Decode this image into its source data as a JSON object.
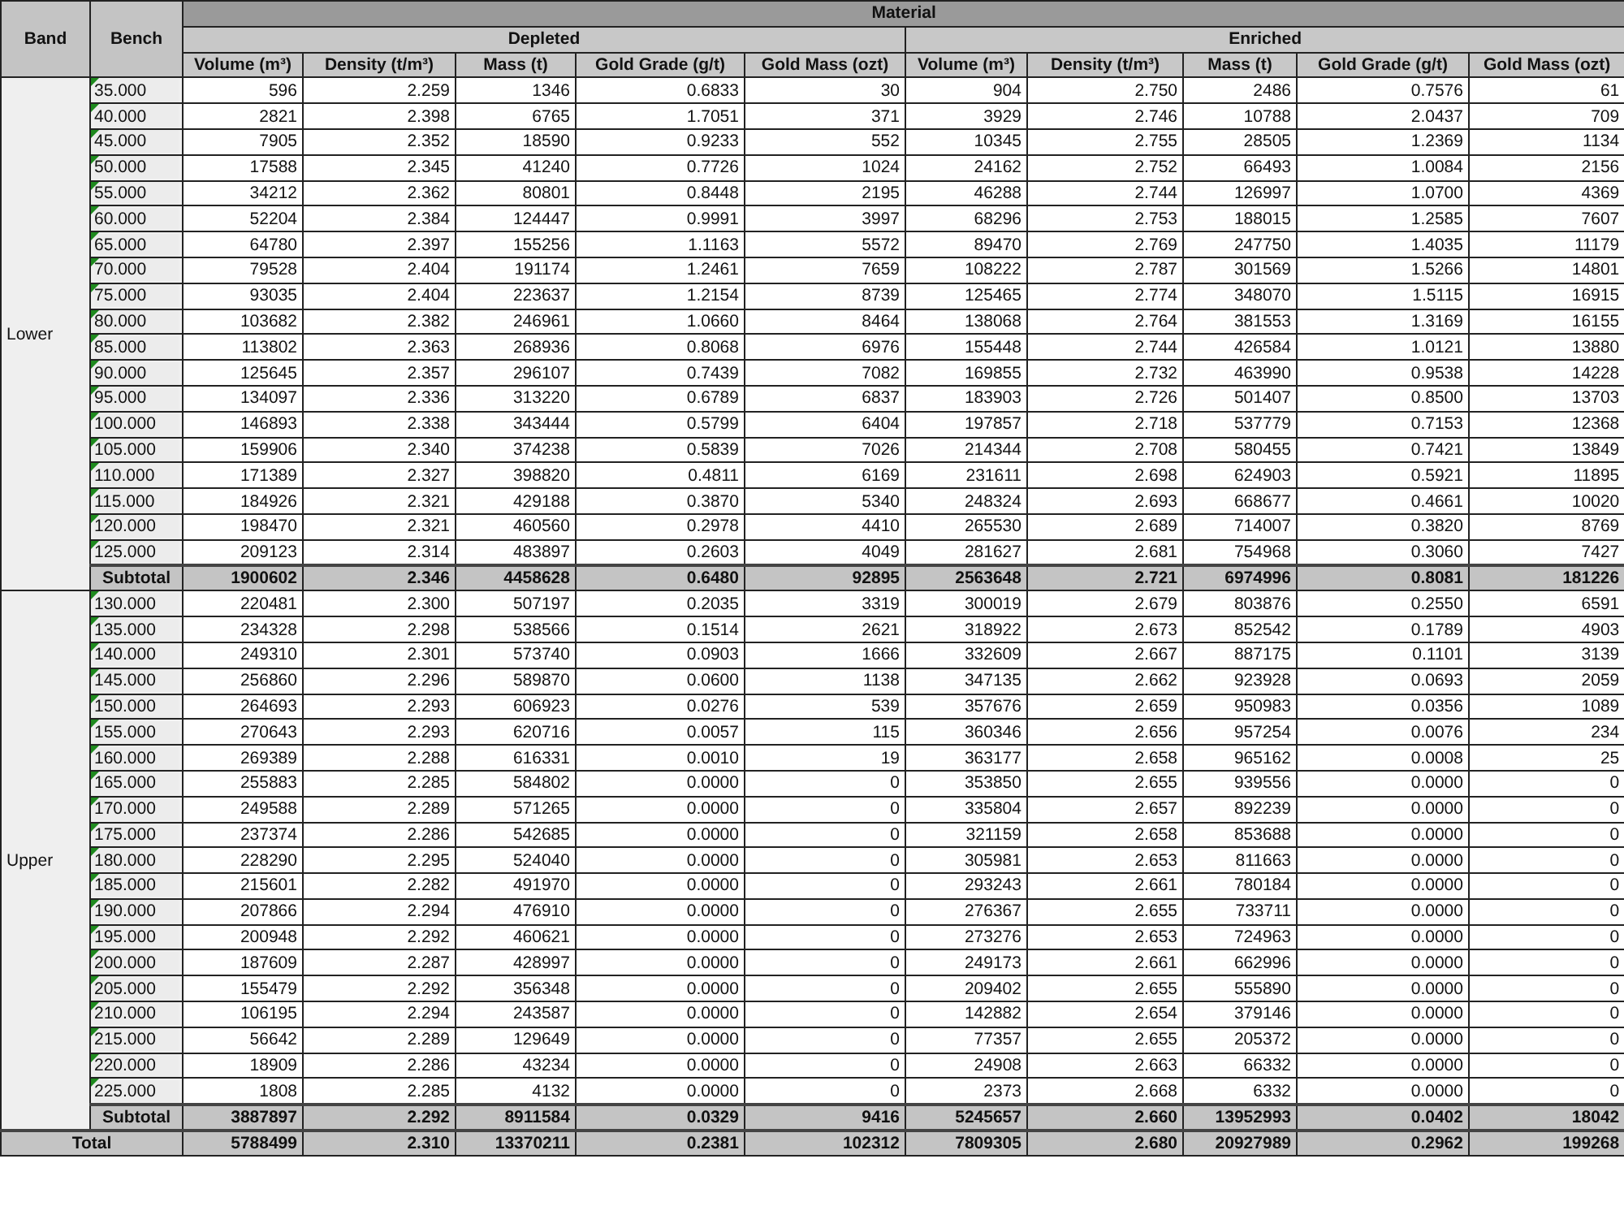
{
  "table": {
    "columns": [
      {
        "label": "Band"
      },
      {
        "label": "Bench"
      }
    ],
    "title": "Material",
    "groups": [
      {
        "name": "Depleted",
        "columns": [
          "Volume (m³)",
          "Density (t/m³)",
          "Mass (t)",
          "Gold Grade (g/t)",
          "Gold Mass (ozt)"
        ]
      },
      {
        "name": "Enriched",
        "columns": [
          "Volume (m³)",
          "Density (t/m³)",
          "Mass (t)",
          "Gold Grade (g/t)",
          "Gold Mass (ozt)"
        ]
      }
    ],
    "bands": [
      {
        "name": "Lower",
        "rows": [
          {
            "bench": "35.000",
            "flagged": true,
            "values": [
              "596",
              "2.259",
              "1346",
              "0.6833",
              "30",
              "904",
              "2.750",
              "2486",
              "0.7576",
              "61"
            ]
          },
          {
            "bench": "40.000",
            "flagged": true,
            "values": [
              "2821",
              "2.398",
              "6765",
              "1.7051",
              "371",
              "3929",
              "2.746",
              "10788",
              "2.0437",
              "709"
            ]
          },
          {
            "bench": "45.000",
            "flagged": true,
            "values": [
              "7905",
              "2.352",
              "18590",
              "0.9233",
              "552",
              "10345",
              "2.755",
              "28505",
              "1.2369",
              "1134"
            ]
          },
          {
            "bench": "50.000",
            "flagged": true,
            "values": [
              "17588",
              "2.345",
              "41240",
              "0.7726",
              "1024",
              "24162",
              "2.752",
              "66493",
              "1.0084",
              "2156"
            ]
          },
          {
            "bench": "55.000",
            "flagged": true,
            "values": [
              "34212",
              "2.362",
              "80801",
              "0.8448",
              "2195",
              "46288",
              "2.744",
              "126997",
              "1.0700",
              "4369"
            ]
          },
          {
            "bench": "60.000",
            "flagged": true,
            "values": [
              "52204",
              "2.384",
              "124447",
              "0.9991",
              "3997",
              "68296",
              "2.753",
              "188015",
              "1.2585",
              "7607"
            ]
          },
          {
            "bench": "65.000",
            "flagged": true,
            "values": [
              "64780",
              "2.397",
              "155256",
              "1.1163",
              "5572",
              "89470",
              "2.769",
              "247750",
              "1.4035",
              "11179"
            ]
          },
          {
            "bench": "70.000",
            "flagged": true,
            "values": [
              "79528",
              "2.404",
              "191174",
              "1.2461",
              "7659",
              "108222",
              "2.787",
              "301569",
              "1.5266",
              "14801"
            ]
          },
          {
            "bench": "75.000",
            "flagged": true,
            "values": [
              "93035",
              "2.404",
              "223637",
              "1.2154",
              "8739",
              "125465",
              "2.774",
              "348070",
              "1.5115",
              "16915"
            ]
          },
          {
            "bench": "80.000",
            "flagged": true,
            "values": [
              "103682",
              "2.382",
              "246961",
              "1.0660",
              "8464",
              "138068",
              "2.764",
              "381553",
              "1.3169",
              "16155"
            ]
          },
          {
            "bench": "85.000",
            "flagged": true,
            "values": [
              "113802",
              "2.363",
              "268936",
              "0.8068",
              "6976",
              "155448",
              "2.744",
              "426584",
              "1.0121",
              "13880"
            ]
          },
          {
            "bench": "90.000",
            "flagged": true,
            "values": [
              "125645",
              "2.357",
              "296107",
              "0.7439",
              "7082",
              "169855",
              "2.732",
              "463990",
              "0.9538",
              "14228"
            ]
          },
          {
            "bench": "95.000",
            "flagged": true,
            "values": [
              "134097",
              "2.336",
              "313220",
              "0.6789",
              "6837",
              "183903",
              "2.726",
              "501407",
              "0.8500",
              "13703"
            ]
          },
          {
            "bench": "100.000",
            "flagged": true,
            "values": [
              "146893",
              "2.338",
              "343444",
              "0.5799",
              "6404",
              "197857",
              "2.718",
              "537779",
              "0.7153",
              "12368"
            ]
          },
          {
            "bench": "105.000",
            "flagged": true,
            "values": [
              "159906",
              "2.340",
              "374238",
              "0.5839",
              "7026",
              "214344",
              "2.708",
              "580455",
              "0.7421",
              "13849"
            ]
          },
          {
            "bench": "110.000",
            "flagged": true,
            "values": [
              "171389",
              "2.327",
              "398820",
              "0.4811",
              "6169",
              "231611",
              "2.698",
              "624903",
              "0.5921",
              "11895"
            ]
          },
          {
            "bench": "115.000",
            "flagged": true,
            "values": [
              "184926",
              "2.321",
              "429188",
              "0.3870",
              "5340",
              "248324",
              "2.693",
              "668677",
              "0.4661",
              "10020"
            ]
          },
          {
            "bench": "120.000",
            "flagged": true,
            "values": [
              "198470",
              "2.321",
              "460560",
              "0.2978",
              "4410",
              "265530",
              "2.689",
              "714007",
              "0.3820",
              "8769"
            ]
          },
          {
            "bench": "125.000",
            "flagged": true,
            "values": [
              "209123",
              "2.314",
              "483897",
              "0.2603",
              "4049",
              "281627",
              "2.681",
              "754968",
              "0.3060",
              "7427"
            ]
          }
        ],
        "subtotal": {
          "label": "Subtotal",
          "values": [
            "1900602",
            "2.346",
            "4458628",
            "0.6480",
            "92895",
            "2563648",
            "2.721",
            "6974996",
            "0.8081",
            "181226"
          ]
        }
      },
      {
        "name": "Upper",
        "rows": [
          {
            "bench": "130.000",
            "flagged": true,
            "values": [
              "220481",
              "2.300",
              "507197",
              "0.2035",
              "3319",
              "300019",
              "2.679",
              "803876",
              "0.2550",
              "6591"
            ]
          },
          {
            "bench": "135.000",
            "flagged": true,
            "values": [
              "234328",
              "2.298",
              "538566",
              "0.1514",
              "2621",
              "318922",
              "2.673",
              "852542",
              "0.1789",
              "4903"
            ]
          },
          {
            "bench": "140.000",
            "flagged": true,
            "values": [
              "249310",
              "2.301",
              "573740",
              "0.0903",
              "1666",
              "332609",
              "2.667",
              "887175",
              "0.1101",
              "3139"
            ]
          },
          {
            "bench": "145.000",
            "flagged": true,
            "values": [
              "256860",
              "2.296",
              "589870",
              "0.0600",
              "1138",
              "347135",
              "2.662",
              "923928",
              "0.0693",
              "2059"
            ]
          },
          {
            "bench": "150.000",
            "flagged": true,
            "values": [
              "264693",
              "2.293",
              "606923",
              "0.0276",
              "539",
              "357676",
              "2.659",
              "950983",
              "0.0356",
              "1089"
            ]
          },
          {
            "bench": "155.000",
            "flagged": true,
            "values": [
              "270643",
              "2.293",
              "620716",
              "0.0057",
              "115",
              "360346",
              "2.656",
              "957254",
              "0.0076",
              "234"
            ]
          },
          {
            "bench": "160.000",
            "flagged": true,
            "values": [
              "269389",
              "2.288",
              "616331",
              "0.0010",
              "19",
              "363177",
              "2.658",
              "965162",
              "0.0008",
              "25"
            ]
          },
          {
            "bench": "165.000",
            "flagged": true,
            "values": [
              "255883",
              "2.285",
              "584802",
              "0.0000",
              "0",
              "353850",
              "2.655",
              "939556",
              "0.0000",
              "0"
            ]
          },
          {
            "bench": "170.000",
            "flagged": true,
            "values": [
              "249588",
              "2.289",
              "571265",
              "0.0000",
              "0",
              "335804",
              "2.657",
              "892239",
              "0.0000",
              "0"
            ]
          },
          {
            "bench": "175.000",
            "flagged": true,
            "values": [
              "237374",
              "2.286",
              "542685",
              "0.0000",
              "0",
              "321159",
              "2.658",
              "853688",
              "0.0000",
              "0"
            ]
          },
          {
            "bench": "180.000",
            "flagged": true,
            "values": [
              "228290",
              "2.295",
              "524040",
              "0.0000",
              "0",
              "305981",
              "2.653",
              "811663",
              "0.0000",
              "0"
            ]
          },
          {
            "bench": "185.000",
            "flagged": true,
            "values": [
              "215601",
              "2.282",
              "491970",
              "0.0000",
              "0",
              "293243",
              "2.661",
              "780184",
              "0.0000",
              "0"
            ]
          },
          {
            "bench": "190.000",
            "flagged": true,
            "values": [
              "207866",
              "2.294",
              "476910",
              "0.0000",
              "0",
              "276367",
              "2.655",
              "733711",
              "0.0000",
              "0"
            ]
          },
          {
            "bench": "195.000",
            "flagged": true,
            "values": [
              "200948",
              "2.292",
              "460621",
              "0.0000",
              "0",
              "273276",
              "2.653",
              "724963",
              "0.0000",
              "0"
            ]
          },
          {
            "bench": "200.000",
            "flagged": true,
            "values": [
              "187609",
              "2.287",
              "428997",
              "0.0000",
              "0",
              "249173",
              "2.661",
              "662996",
              "0.0000",
              "0"
            ]
          },
          {
            "bench": "205.000",
            "flagged": true,
            "values": [
              "155479",
              "2.292",
              "356348",
              "0.0000",
              "0",
              "209402",
              "2.655",
              "555890",
              "0.0000",
              "0"
            ]
          },
          {
            "bench": "210.000",
            "flagged": true,
            "values": [
              "106195",
              "2.294",
              "243587",
              "0.0000",
              "0",
              "142882",
              "2.654",
              "379146",
              "0.0000",
              "0"
            ]
          },
          {
            "bench": "215.000",
            "flagged": true,
            "values": [
              "56642",
              "2.289",
              "129649",
              "0.0000",
              "0",
              "77357",
              "2.655",
              "205372",
              "0.0000",
              "0"
            ]
          },
          {
            "bench": "220.000",
            "flagged": true,
            "values": [
              "18909",
              "2.286",
              "43234",
              "0.0000",
              "0",
              "24908",
              "2.663",
              "66332",
              "0.0000",
              "0"
            ]
          },
          {
            "bench": "225.000",
            "flagged": true,
            "values": [
              "1808",
              "2.285",
              "4132",
              "0.0000",
              "0",
              "2373",
              "2.668",
              "6332",
              "0.0000",
              "0"
            ]
          }
        ],
        "subtotal": {
          "label": "Subtotal",
          "values": [
            "3887897",
            "2.292",
            "8911584",
            "0.0329",
            "9416",
            "5245657",
            "2.660",
            "13952993",
            "0.0402",
            "18042"
          ]
        }
      }
    ],
    "total": {
      "label": "Total",
      "values": [
        "5788499",
        "2.310",
        "13370211",
        "0.2381",
        "102312",
        "7809305",
        "2.680",
        "20927989",
        "0.2962",
        "199268"
      ]
    }
  }
}
